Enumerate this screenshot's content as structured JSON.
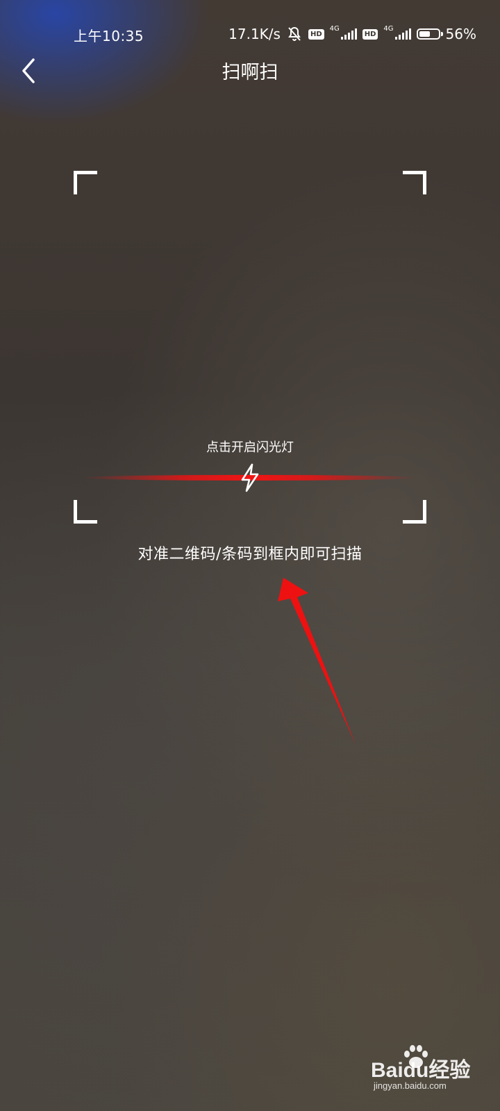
{
  "status_bar": {
    "time": "上午10:35",
    "net_speed": "17.1K/s",
    "sim1": {
      "badge": "HD",
      "network": "4G"
    },
    "sim2": {
      "badge": "HD",
      "network": "4G"
    },
    "battery_percent": "56%",
    "battery_level": 0.56,
    "icons": [
      "mute-bell-icon",
      "signal-bars-icon",
      "battery-icon"
    ]
  },
  "header": {
    "back_icon": "chevron-left-icon",
    "title": "扫啊扫"
  },
  "scanner": {
    "flash_hint": "点击开启闪光灯",
    "flash_icon": "lightning-bolt-icon",
    "instruction": "对准二维码/条码到框内即可扫描",
    "scan_line_color": "#e61414"
  },
  "annotation": {
    "arrow_color": "#ee1111"
  },
  "watermark": {
    "brand": "Baidu经验",
    "url": "jingyan.baidu.com"
  }
}
